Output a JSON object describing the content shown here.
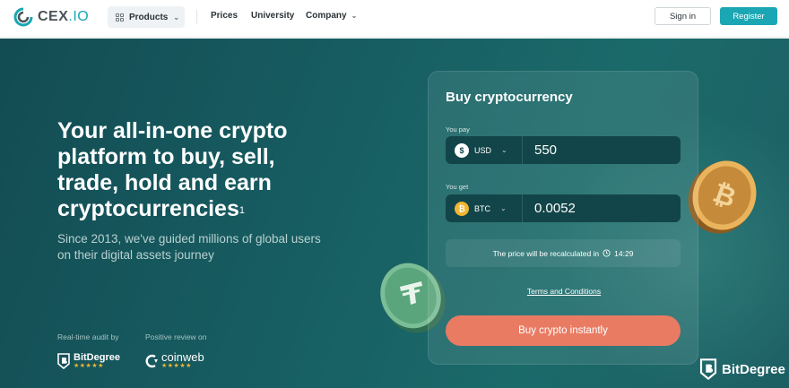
{
  "header": {
    "logo_text": "CEX",
    "logo_suffix": ".IO",
    "products_label": "Products",
    "nav": [
      "Prices",
      "University",
      "Company"
    ],
    "signin_label": "Sign in",
    "register_label": "Register"
  },
  "hero": {
    "headline": "Your all-in-one crypto platform to buy, sell, trade, hold and earn cryptocurrencies",
    "headline_sup": "1",
    "subtext": "Since 2013, we've guided millions of global users on their digital assets journey",
    "audit_label": "Real-time audit by",
    "review_label": "Positive review on",
    "audit_brand": "BitDegree",
    "review_brand": "coinweb",
    "stars": "★★★★★"
  },
  "card": {
    "title": "Buy cryptocurrency",
    "pay_label": "You pay",
    "pay_currency": "USD",
    "pay_icon": "$",
    "pay_amount": "550",
    "get_label": "You get",
    "get_currency": "BTC",
    "get_icon": "₿",
    "get_amount": "0.0052",
    "recalc_text": "The price will be recalculated in",
    "recalc_time": "14:29",
    "terms": "Terms and Conditions",
    "buy_button": "Buy crypto instantly"
  },
  "watermark": {
    "text": "BitDegree"
  },
  "colors": {
    "accent": "#1aa7b3",
    "cta": "#e97b63",
    "hero_bg": "#175f63"
  }
}
